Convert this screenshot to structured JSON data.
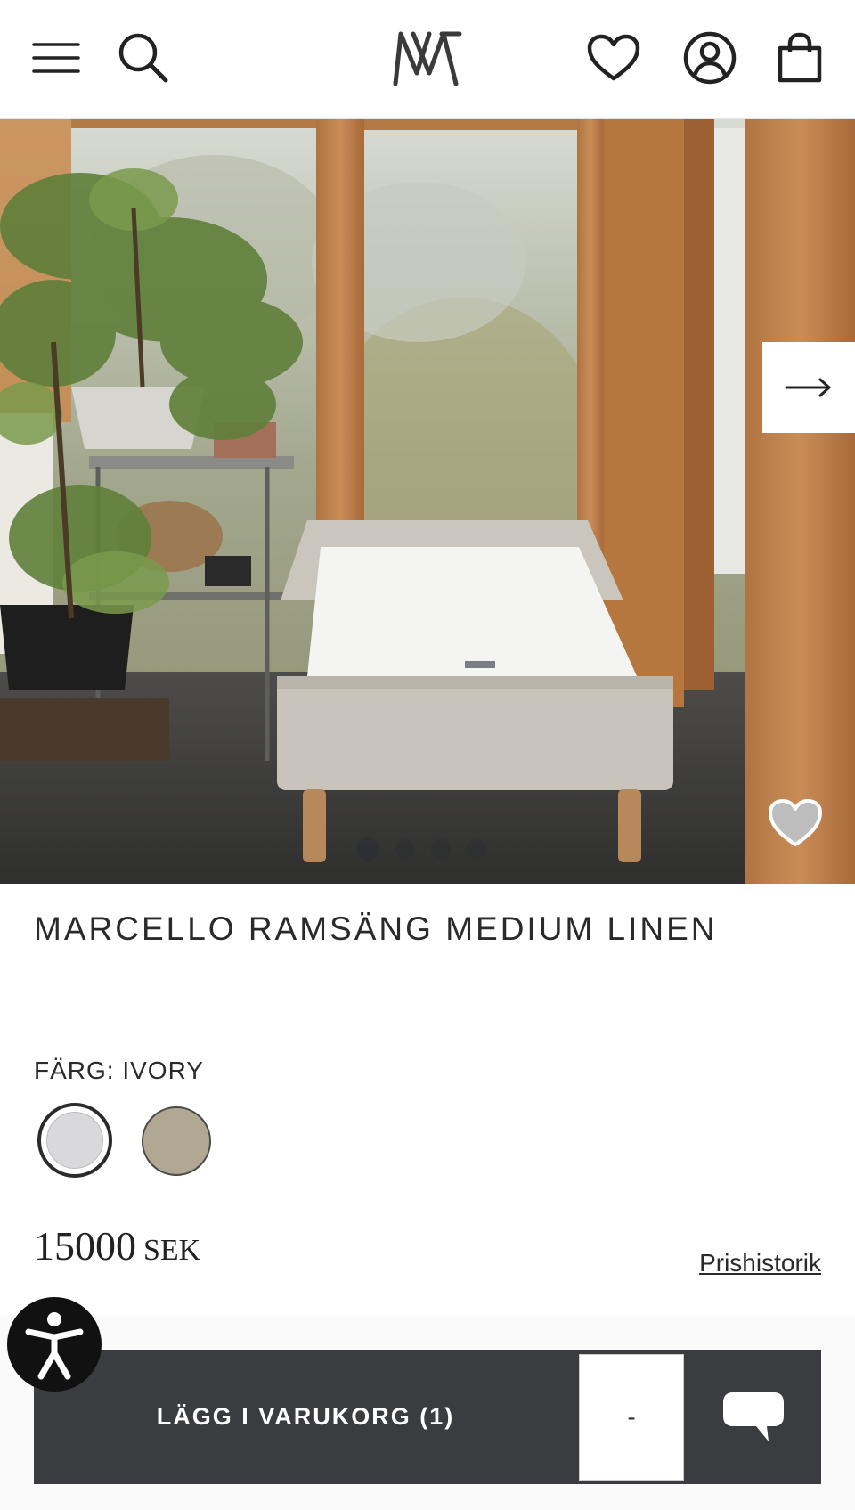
{
  "header": {
    "menu_icon": "hamburger-menu-icon",
    "search_icon": "search-icon",
    "logo": "brand-monogram-logo",
    "wishlist_icon": "heart-icon",
    "account_icon": "user-icon",
    "cart_icon": "shopping-bag-icon"
  },
  "gallery": {
    "next_icon": "arrow-right-icon",
    "favorite_icon": "heart-filled-icon",
    "slide_count": 4,
    "active_slide": 1
  },
  "product": {
    "title": "MARCELLO RAMSÄNG MEDIUM LINEN",
    "color_label": "FÄRG: IVORY",
    "swatches": [
      {
        "color": "#d9d9db",
        "selected": true
      },
      {
        "color": "#b0a892",
        "selected": false
      }
    ],
    "price_amount": "15000",
    "price_currency": "SEK",
    "price_history_link": "Prishistorik"
  },
  "actions": {
    "add_to_cart_label": "LÄGG I VARUKORG (1)",
    "quantity_label": "-",
    "chat_icon": "chat-bubble-icon",
    "accessibility_icon": "accessibility-person-icon"
  }
}
